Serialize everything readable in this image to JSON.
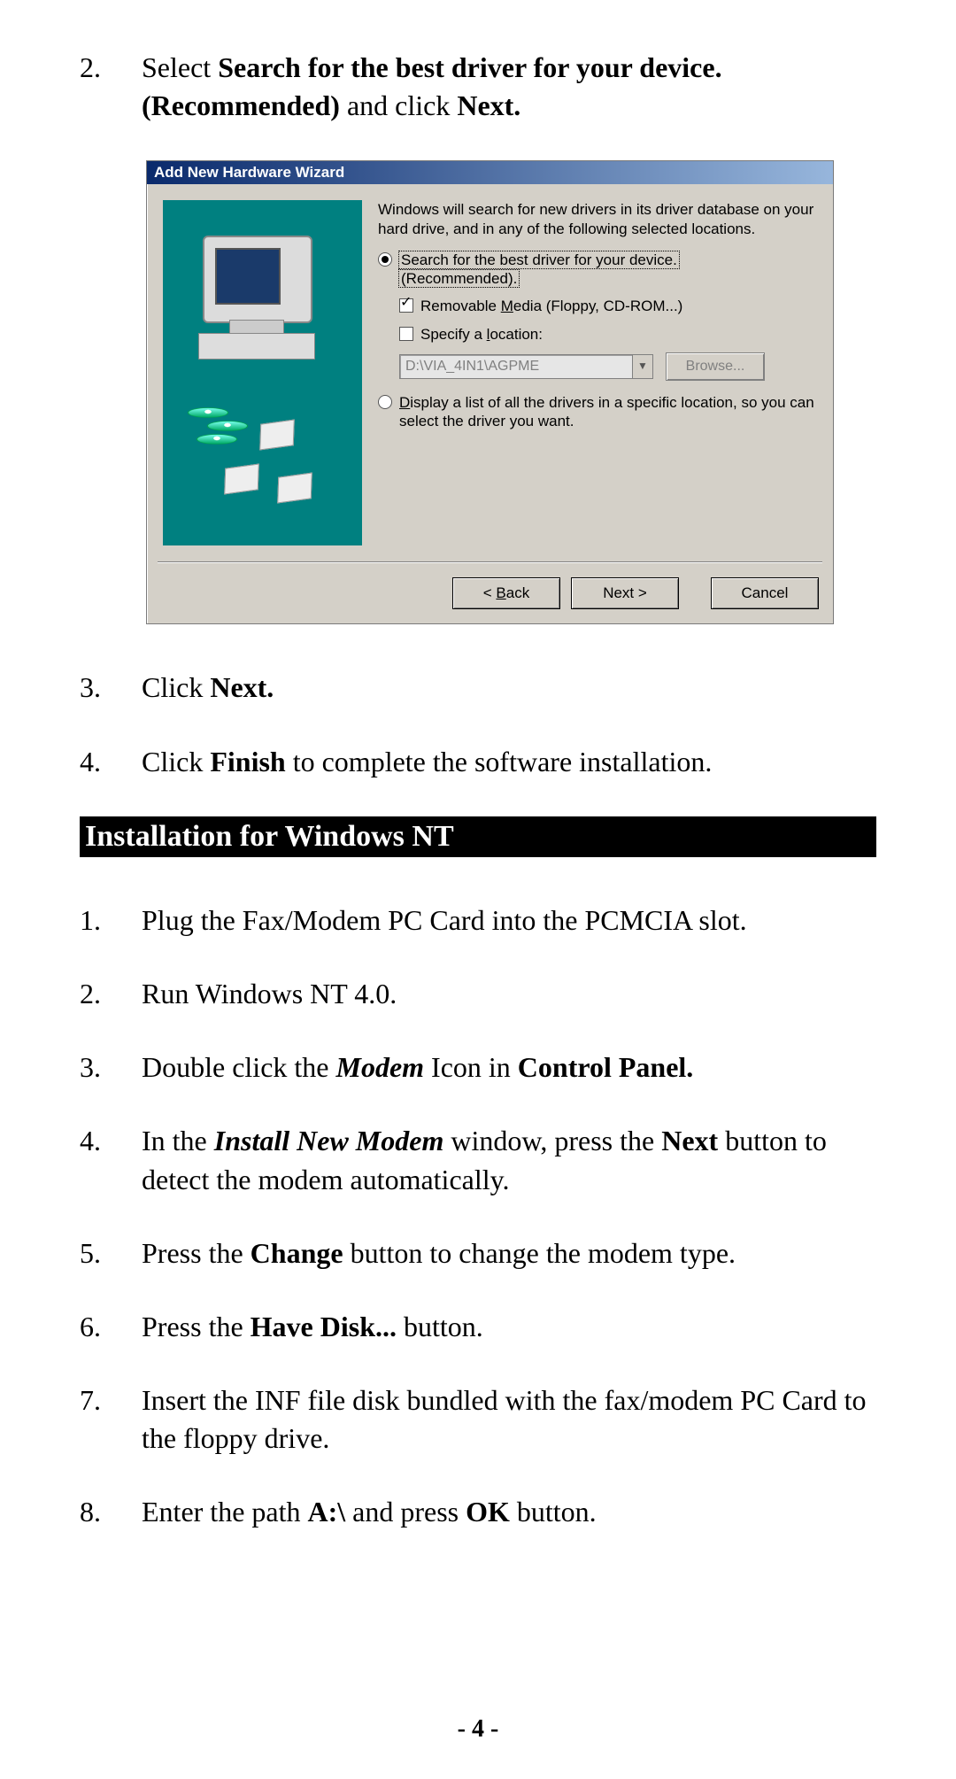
{
  "steps_top": [
    {
      "num": "2.",
      "html": "Select <b>Search for the best driver for your device. (Recommended)</b> and click <b>Next.</b>"
    },
    {
      "num": "3.",
      "html": "Click <b>Next.</b>"
    },
    {
      "num": "4.",
      "html": "Click <b>Finish</b> to complete the software installation."
    }
  ],
  "section_heading": "Installation for Windows NT",
  "steps_nt": [
    {
      "num": "1.",
      "html": "Plug the Fax/Modem PC Card into the PCMCIA slot."
    },
    {
      "num": "2.",
      "html": "Run Windows NT 4.0."
    },
    {
      "num": "3.",
      "html": "Double click the <b><i>Modem</i></b> Icon in <b>Control Panel.</b>"
    },
    {
      "num": "4.",
      "html": "In the <b><i>Install New Modem</i></b> window, press the <b>Next</b> button to detect the modem automatically."
    },
    {
      "num": "5.",
      "html": "Press the <b>Change</b> button to change the modem type."
    },
    {
      "num": "6.",
      "html": "Press the <b>Have Disk...</b> button."
    },
    {
      "num": "7.",
      "html": "Insert the INF file disk bundled with the fax/modem PC Card to the floppy drive."
    },
    {
      "num": "8.",
      "html": "Enter the path <b>A:\\</b> and press <b>OK</b> button."
    }
  ],
  "page_number": "- 4 -",
  "dialog": {
    "title": "Add New Hardware Wizard",
    "intro": "Windows will search for new drivers in its driver database on your hard drive, and in any of the following selected locations.",
    "radio1a": "Search for the best driver for your device.",
    "radio1b": "(Recommended).",
    "check1_pre": "Removable ",
    "check1_u": "M",
    "check1_post": "edia (Floppy, CD-ROM...)",
    "check2_pre": "Specify a ",
    "check2_u": "l",
    "check2_post": "ocation:",
    "path_value": "D:\\VIA_4IN1\\AGPME",
    "browse": "Browse...",
    "radio2_u": "D",
    "radio2_post": "isplay a list of all the drivers in a specific location, so you can select the driver you want.",
    "back_pre": "< ",
    "back_u": "B",
    "back_post": "ack",
    "next": "Next >",
    "cancel": "Cancel"
  }
}
